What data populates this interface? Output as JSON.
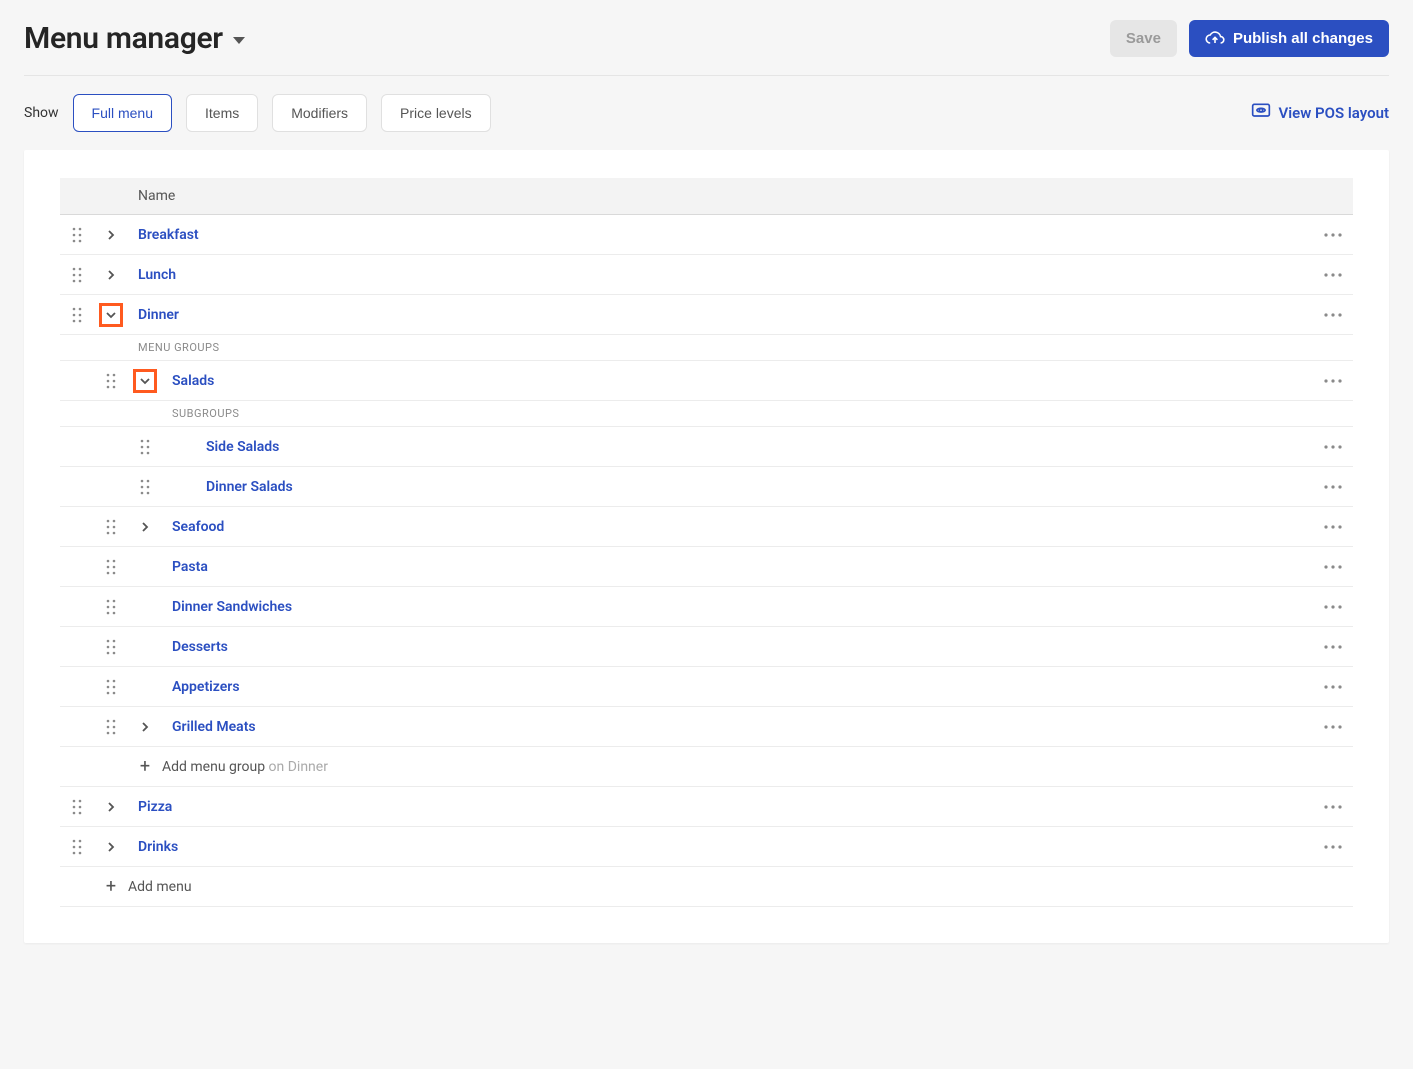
{
  "header": {
    "title": "Menu manager",
    "save_label": "Save",
    "publish_label": "Publish all changes"
  },
  "toolbar": {
    "show_label": "Show",
    "tabs": [
      {
        "label": "Full menu",
        "active": true
      },
      {
        "label": "Items",
        "active": false
      },
      {
        "label": "Modifiers",
        "active": false
      },
      {
        "label": "Price levels",
        "active": false
      }
    ],
    "view_pos_label": "View POS layout"
  },
  "table": {
    "name_header": "Name",
    "menu_groups_label": "MENU GROUPS",
    "subgroups_label": "SUBGROUPS",
    "menus": {
      "breakfast": "Breakfast",
      "lunch": "Lunch",
      "dinner": "Dinner",
      "pizza": "Pizza",
      "drinks": "Drinks"
    },
    "dinner_groups": {
      "salads": "Salads",
      "seafood": "Seafood",
      "pasta": "Pasta",
      "dinner_sandwiches": "Dinner Sandwiches",
      "desserts": "Desserts",
      "appetizers": "Appetizers",
      "grilled_meats": "Grilled Meats"
    },
    "salad_subgroups": {
      "side_salads": "Side Salads",
      "dinner_salads": "Dinner Salads"
    },
    "add_menu_group_label": "Add menu group",
    "add_menu_group_suffix": "on Dinner",
    "add_menu_label": "Add menu"
  }
}
